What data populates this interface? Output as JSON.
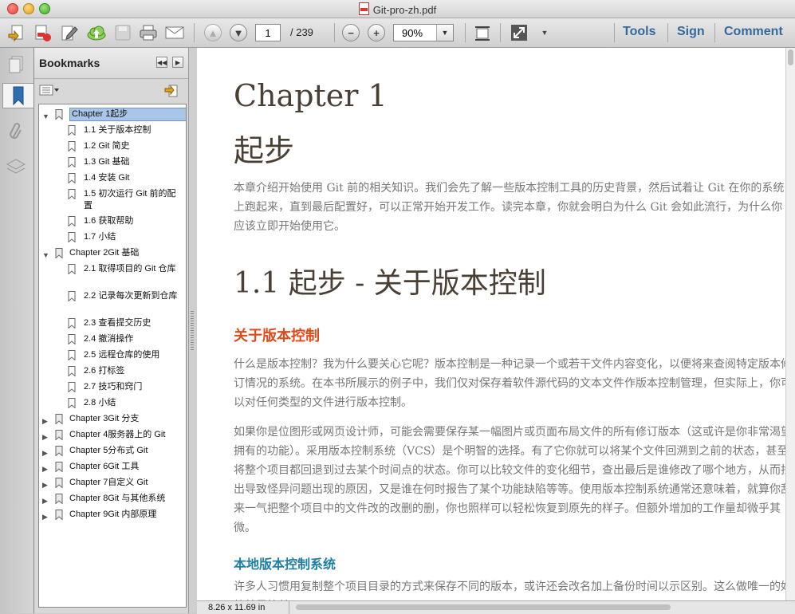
{
  "window": {
    "title": "Git-pro-zh.pdf"
  },
  "toolbar": {
    "current_page": "1",
    "page_total": "/ 239",
    "zoom": "90%",
    "links": {
      "tools": "Tools",
      "sign": "Sign",
      "comment": "Comment"
    }
  },
  "sidebar": {
    "title": "Bookmarks",
    "bookmarks": [
      {
        "label": "Chapter 1起步",
        "expanded": true,
        "selected": true
      },
      {
        "label": "1.1 关于版本控制"
      },
      {
        "label": "1.2 Git 简史"
      },
      {
        "label": "1.3 Git 基础"
      },
      {
        "label": "1.4 安装 Git"
      },
      {
        "label": "1.5 初次运行 Git 前的配置"
      },
      {
        "label": "1.6 获取帮助"
      },
      {
        "label": "1.7 小结"
      },
      {
        "label": "Chapter 2Git 基础",
        "expanded": true
      },
      {
        "label": "2.1 取得项目的 Git 仓库"
      },
      {
        "label": "2.2 记录每次更新到仓库"
      },
      {
        "label": "2.3 查看提交历史"
      },
      {
        "label": "2.4 撤消操作"
      },
      {
        "label": "2.5 远程仓库的使用"
      },
      {
        "label": "2.6 打标签"
      },
      {
        "label": "2.7 技巧和窍门"
      },
      {
        "label": "2.8 小结"
      },
      {
        "label": "Chapter 3Git 分支",
        "expanded": false
      },
      {
        "label": "Chapter 4服务器上的 Git",
        "expanded": false
      },
      {
        "label": "Chapter 5分布式 Git",
        "expanded": false
      },
      {
        "label": "Chapter 6Git 工具",
        "expanded": false
      },
      {
        "label": "Chapter 7自定义 Git",
        "expanded": false
      },
      {
        "label": "Chapter 8Git 与其他系统",
        "expanded": false
      },
      {
        "label": "Chapter 9Git 内部原理",
        "expanded": false
      }
    ]
  },
  "document": {
    "chapter_en": "Chapter 1",
    "chapter_zh": "起步",
    "intro": "本章介绍开始使用 Git 前的相关知识。我们会先了解一些版本控制工具的历史背景，然后试着让 Git 在你的系统上跑起来，直到最后配置好，可以正常开始开发工作。读完本章，你就会明白为什么 Git 会如此流行，为什么你应该立即开始使用它。",
    "section_title": "1.1 起步 - 关于版本控制",
    "sub1": "关于版本控制",
    "p1": "什么是版本控制？我为什么要关心它呢？版本控制是一种记录一个或若干文件内容变化，以便将来查阅特定版本修订情况的系统。在本书所展示的例子中，我们仅对保存着软件源代码的文本文件作版本控制管理，但实际上，你可以对任何类型的文件进行版本控制。",
    "p2": "如果你是位图形或网页设计师，可能会需要保存某一幅图片或页面布局文件的所有修订版本（这或许是你非常渴望拥有的功能）。采用版本控制系统（VCS）是个明智的选择。有了它你就可以将某个文件回溯到之前的状态，甚至将整个项目都回退到过去某个时间点的状态。你可以比较文件的变化细节，查出最后是谁修改了哪个地方，从而找出导致怪异问题出现的原因，又是谁在何时报告了某个功能缺陷等等。使用版本控制系统通常还意味着，就算你乱来一气把整个项目中的文件改的改删的删，你也照样可以轻松恢复到原先的样子。但额外增加的工作量却微乎其微。",
    "sub2": "本地版本控制系统",
    "p3": "许多人习惯用复制整个项目目录的方式来保存不同的版本，或许还会改名加上备份时间以示区别。这么做唯一的好处就是简单。"
  },
  "statusbar": {
    "page_size": "8.26 x 11.69 in"
  }
}
